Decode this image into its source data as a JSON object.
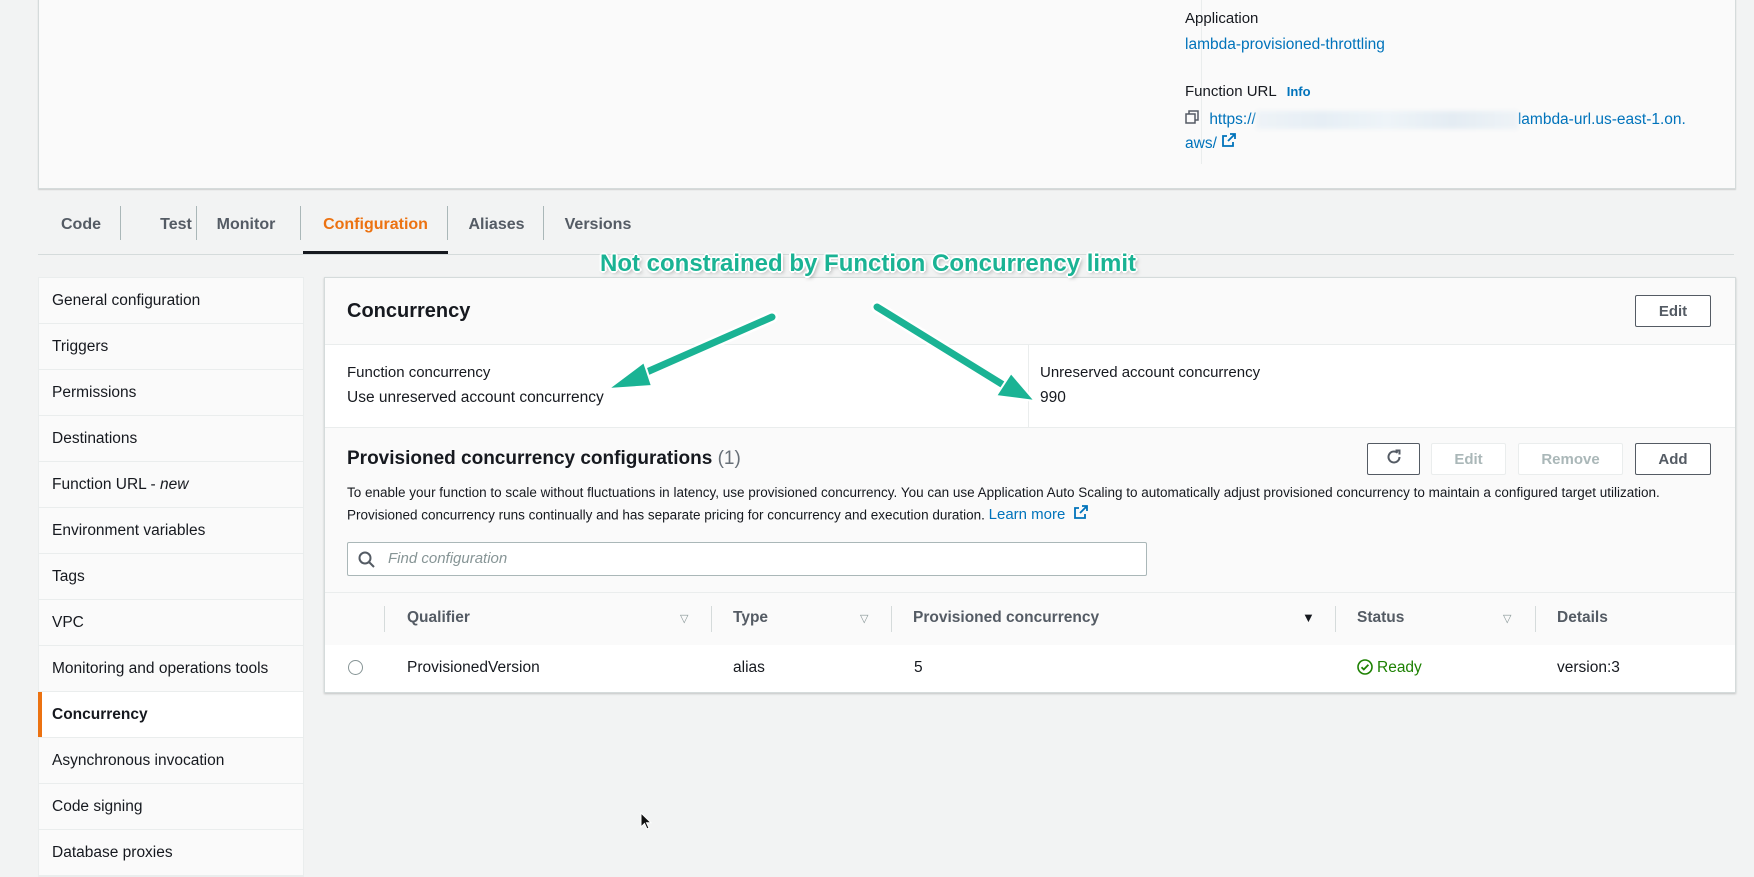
{
  "overview": {
    "application_label": "Application",
    "application_link": "lambda-provisioned-throttling",
    "function_url_label": "Function URL",
    "info_label": "Info",
    "url_prefix": "https://",
    "url_suffix": "lambda-url.us-east-1.on.",
    "url_line2": "aws/"
  },
  "tabs": [
    {
      "label": "Code"
    },
    {
      "label": "Test"
    },
    {
      "label": "Monitor"
    },
    {
      "label": "Configuration",
      "active": true
    },
    {
      "label": "Aliases"
    },
    {
      "label": "Versions"
    }
  ],
  "sidebar": {
    "items": [
      {
        "label": "General configuration"
      },
      {
        "label": "Triggers"
      },
      {
        "label": "Permissions"
      },
      {
        "label": "Destinations"
      },
      {
        "label": "Function URL - ",
        "suffix": "new"
      },
      {
        "label": "Environment variables"
      },
      {
        "label": "Tags"
      },
      {
        "label": "VPC"
      },
      {
        "label": "Monitoring and operations tools"
      },
      {
        "label": "Concurrency",
        "active": true
      },
      {
        "label": "Asynchronous invocation"
      },
      {
        "label": "Code signing"
      },
      {
        "label": "Database proxies"
      }
    ]
  },
  "concurrency": {
    "title": "Concurrency",
    "edit_label": "Edit",
    "function_concurrency_label": "Function concurrency",
    "function_concurrency_value": "Use unreserved account concurrency",
    "unreserved_label": "Unreserved account concurrency",
    "unreserved_value": "990"
  },
  "provisioned": {
    "title": "Provisioned concurrency configurations",
    "count": "(1)",
    "refresh_icon": "refresh-icon",
    "edit_label": "Edit",
    "remove_label": "Remove",
    "add_label": "Add",
    "description_line1": "To enable your function to scale without fluctuations in latency, use provisioned concurrency. You can use Application Auto Scaling to automatically adjust provisioned concurrency to maintain a configured target utilization.",
    "description_line2": "Provisioned concurrency runs continually and has separate pricing for concurrency and execution duration.",
    "learn_more": "Learn more",
    "search_placeholder": "Find configuration",
    "columns": [
      "Qualifier",
      "Type",
      "Provisioned concurrency",
      "Status",
      "Details"
    ],
    "rows": [
      {
        "qualifier": "ProvisionedVersion",
        "type": "alias",
        "provisioned_concurrency": "5",
        "status": "Ready",
        "details": "version:3"
      }
    ]
  },
  "annotation": {
    "text": "Not constrained by Function Concurrency limit",
    "color": "#1ab394"
  },
  "colors": {
    "accent_orange": "#ec7211",
    "link_blue": "#0073bb",
    "success_green": "#1d8102"
  }
}
